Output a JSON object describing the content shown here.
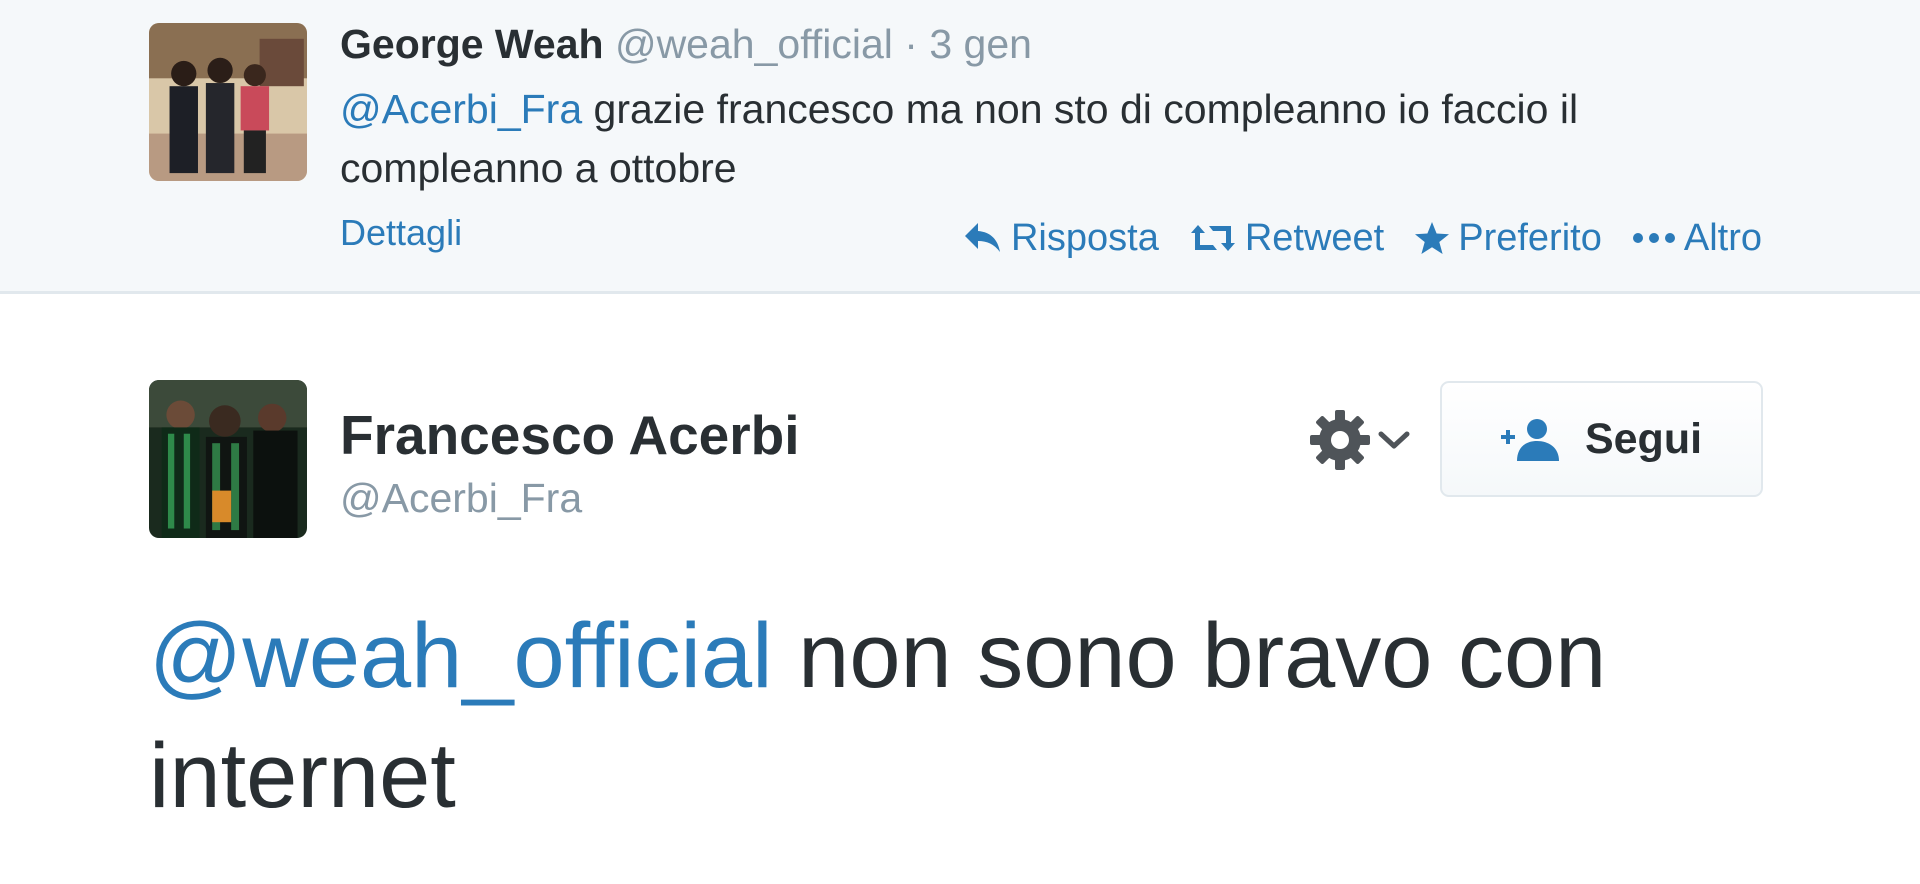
{
  "reply": {
    "name": "George Weah",
    "handle": "@weah_official",
    "separator": "·",
    "time": "3 gen",
    "mention": "@Acerbi_Fra",
    "text": " grazie francesco ma non sto di compleanno io faccio il compleanno a ottobre",
    "details_label": "Dettagli",
    "actions": {
      "reply_label": "Risposta",
      "retweet_label": "Retweet",
      "favorite_label": "Preferito",
      "more_label": "Altro"
    },
    "icons": [
      "reply-icon",
      "retweet-icon",
      "star-icon",
      "ellipsis-icon"
    ]
  },
  "main": {
    "name": "Francesco Acerbi",
    "handle": "@Acerbi_Fra",
    "follow_label": "Segui",
    "mention": "@weah_official",
    "text": " non sono bravo con internet",
    "icons": [
      "gear-icon",
      "chevron-down-icon",
      "add-user-icon"
    ]
  },
  "colors": {
    "link": "#2b7bb9",
    "text": "#292f33",
    "muted": "#8899a6",
    "reply_background": "#f5f8fa",
    "border": "#e1e8ed"
  }
}
